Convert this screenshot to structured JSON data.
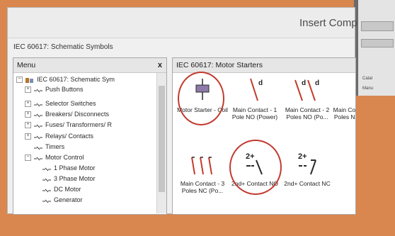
{
  "dialog": {
    "title": "Insert Comp"
  },
  "library": {
    "heading": "IEC 60617: Schematic Symbols"
  },
  "menu_pane": {
    "header": "Menu",
    "close": "x",
    "root": "IEC 60617: Schematic Sym",
    "items": [
      "Push Buttons",
      "Selector Switches",
      "Breakers/ Disconnects",
      "Fuses/ Transformers/ R",
      "Relays/ Contacts",
      "Timers",
      "Motor Control",
      "1 Phase Motor",
      "3 Phase Motor",
      "DC Motor",
      "Generator"
    ]
  },
  "symbols_pane": {
    "header": "IEC 60617: Motor Starters",
    "tiles": [
      {
        "label": "Motor Starter - Coil"
      },
      {
        "label": "Main Contact - 1 Pole NO (Power)"
      },
      {
        "label": "Main Contact - 2 Poles NO (Po..."
      },
      {
        "label": "Main Contact - 3 Poles NC (Po..."
      },
      {
        "label": "2nd+ Contact NO"
      },
      {
        "label": "2nd+ Contact NC"
      }
    ],
    "contact_prefix": "2+"
  },
  "background_window": {
    "labels": [
      "Catal",
      "Manu"
    ],
    "partial_tile_label": "Main Cont Poles NO"
  },
  "colors": {
    "highlight": "#c23a2f",
    "backdrop": "#d9864f"
  }
}
